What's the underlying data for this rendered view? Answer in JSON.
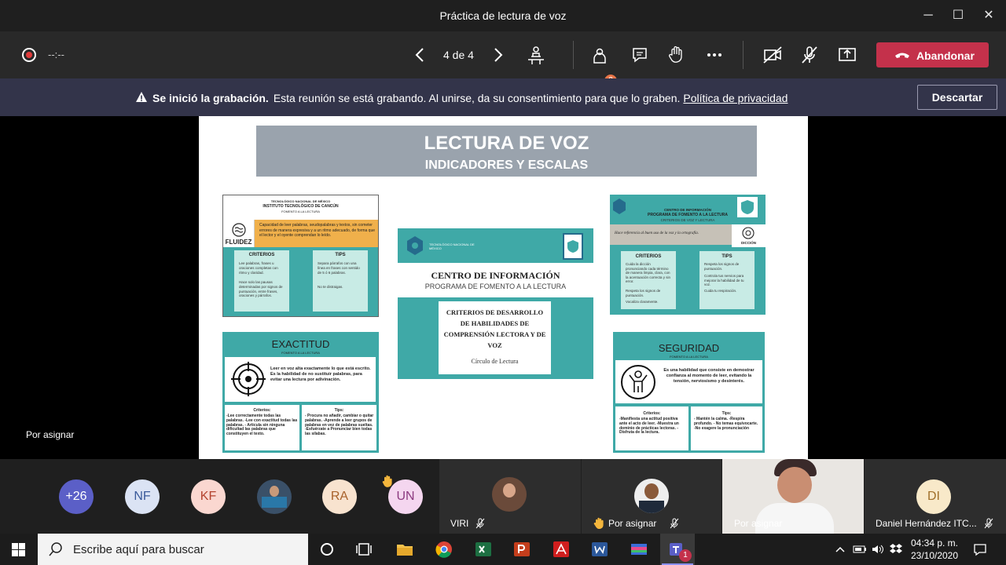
{
  "window": {
    "title": "Práctica de lectura de voz",
    "controls": {
      "minimize": "─",
      "maximize": "☐",
      "close": "✕"
    }
  },
  "toolbar": {
    "timer": "--:--",
    "page_indicator": "4 de 4",
    "participants_badge": "2",
    "leave_label": "Abandonar",
    "leave_color": "#c4314b"
  },
  "banner": {
    "bold": "Se inició la grabación.",
    "text": "Esta reunión se está grabando. Al unirse, da su consentimiento para que lo graben.",
    "link": "Política de privacidad",
    "dismiss": "Descartar"
  },
  "slide": {
    "title": "LECTURA DE VOZ",
    "subtitle": "INDICADORES Y ESCALAS",
    "fluidez": {
      "inst1": "TECNOLÓGICO NACIONAL DE MÉXICO",
      "inst2": "INSTITUTO TECNOLÓGICO DE CANCÚN",
      "inst3": "FOMENTO A LA LECTURA",
      "label": "FLUIDEZ",
      "desc": "Capacidad de leer palabras, seudopalabras y textos, sin cometer errores de manera expresiva y a un ritmo adecuado, de forma que el lector y el oyente comprendan lo leído.",
      "criteria_title": "CRITERIOS",
      "criteria": [
        "Lee palabras, frases u oraciones completas con ritmo y claridad.",
        "Hace solo las pausas determinadas por signos de puntuación, entre frases, oraciones y párrafos."
      ],
      "tips_title": "TIPS",
      "tips": [
        "Separa párrafos con una línea en frases con sentido de 5 ó 6 palabras.",
        "No te distraigas."
      ]
    },
    "center": {
      "logo_text": "TECNOLÓGICO NACIONAL DE MÉXICO",
      "title": "CENTRO DE INFORMACIÓN",
      "subtitle": "PROGRAMA DE FOMENTO A LA LECTURA",
      "card_title": "CRITERIOS DE DESARROLLO DE HABILIDADES DE COMPRENSIÓN LECTORA Y DE VOZ",
      "card_sub": "Círculo de Lectura"
    },
    "diccion": {
      "h1": "CENTRO DE INFORMACIÓN",
      "h2": "PROGRAMA DE FOMENTO A LA LECTURA",
      "h3": "CRITERIOS DE VOZ Y LECTURA",
      "desc": "Hace referencia al buen uso de la voz y la ortografía.",
      "label": "DICCIÓN",
      "criteria_title": "CRITERIOS",
      "criteria": [
        "Cuida la dicción pronunciando cada término de manera limpia, clara, con la acentuación correcta y sin error.",
        "Respeta los signos de puntuación.",
        "Vocaliza claramente."
      ],
      "tips_title": "TIPS",
      "tips": [
        "Respeta los signos de puntuación.",
        "Controla tus nervios para mejorar la habilidad de tu voz.",
        "Cuida tu respiración."
      ]
    },
    "exactitud": {
      "title": "EXACTITUD",
      "sub": "FOMENTO A LA LECTURA",
      "desc": "Leer en voz alta exactamente lo que está escrito. Es la habilidad de no sustituir palabras, para evitar una lectura por adivinación.",
      "criteria_title": "Criterios:",
      "criteria": "-Lee correctamente todas las palabras. -Lee con exactitud todas las palabras. - Articula sin ninguna dificultad las palabras que constituyen el texto.",
      "tips_title": "Tips:",
      "tips": "- Procura no añadir, cambiar o quitar palabras. -Aprende a leer grupos de palabras en vez de palabras sueltas. -Esfuérzate a Pronunciar bien todas las sílabas."
    },
    "seguridad": {
      "title": "SEGURIDAD",
      "sub": "FOMENTO A LA LECTURA",
      "desc": "Es una habilidad que consiste en demostrar confianza al momento de leer, evitando la tensión, nerviosismo y desinterés.",
      "criteria_title": "Criterios:",
      "criteria": "-Manifiesta una actitud positiva ante el acto de leer. -Muestra un dominio de prácticas lectoras. - Disfruta de la lectura.",
      "tips_title": "Tips:",
      "tips": "- Mantén la calma. -Respira profundo. - No temas equivocarte. -No exagere la pronunciación"
    }
  },
  "stage_label": "Por asignar",
  "participants": {
    "overflow": "+26",
    "avatars": [
      {
        "initials": "NF",
        "bg": "#dbe3f4",
        "fg": "#3a5a9a"
      },
      {
        "initials": "KF",
        "bg": "#fad7d0",
        "fg": "#b4432e"
      },
      {
        "initials": "RA",
        "bg": "#f8e3cf",
        "fg": "#a8612a"
      },
      {
        "initials": "UN",
        "bg": "#f4d6ef",
        "fg": "#8c3a80"
      }
    ],
    "tiles": [
      {
        "name": "VIRI"
      },
      {
        "name": "Por asignar"
      },
      {
        "name": "Por asignar"
      },
      {
        "name": "Daniel Hernández ITC...",
        "initials": "DI"
      }
    ]
  },
  "taskbar": {
    "search_placeholder": "Escribe aquí para buscar",
    "time": "04:34 p. m.",
    "date": "23/10/2020",
    "teams_badge": "1"
  }
}
